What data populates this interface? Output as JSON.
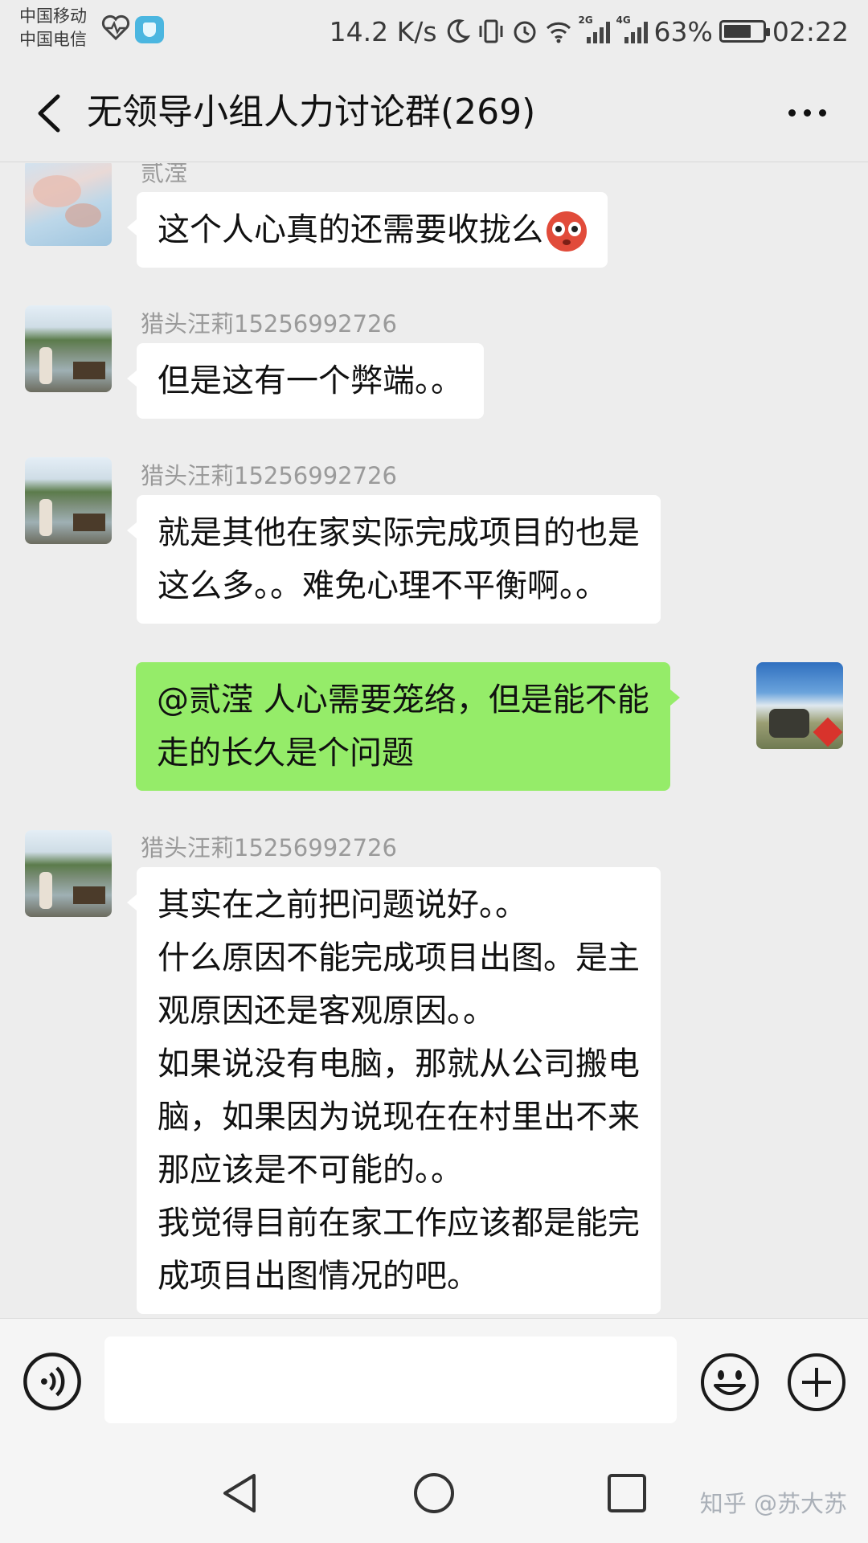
{
  "status_bar": {
    "carrier_1": "中国移动",
    "carrier_2": "中国电信",
    "net_speed": "14.2 K/s",
    "net_2g": "2G",
    "net_4g": "4G",
    "battery_percent": "63%",
    "battery_level": 0.63,
    "time": "02:22"
  },
  "header": {
    "title": "无领导小组人力讨论群(269)"
  },
  "messages": [
    {
      "sender": "贰滢",
      "direction": "in",
      "avatar": "blossom-avatar",
      "lines": [
        "这个人心真的还需要收拢么"
      ],
      "emoji": "flushed-face"
    },
    {
      "sender": "猎头汪莉15256992726",
      "direction": "in",
      "avatar": "lake-avatar",
      "lines": [
        "但是这有一个弊端。。"
      ]
    },
    {
      "sender": "猎头汪莉15256992726",
      "direction": "in",
      "avatar": "lake-avatar",
      "lines": [
        "就是其他在家实际完成项目的也是",
        "这么多。。难免心理不平衡啊。。"
      ]
    },
    {
      "sender": "",
      "direction": "out",
      "avatar": "jeep-avatar",
      "lines": [
        "@贰滢  人心需要笼络，但是能不能",
        "走的长久是个问题"
      ]
    },
    {
      "sender": "猎头汪莉15256992726",
      "direction": "in",
      "avatar": "lake-avatar",
      "lines": [
        "其实在之前把问题说好。。",
        "什么原因不能完成项目出图。是主",
        "观原因还是客观原因。。",
        "如果说没有电脑，那就从公司搬电",
        "脑，如果因为说现在在村里出不来",
        "那应该是不可能的。。",
        "我觉得目前在家工作应该都是能完",
        "成项目出图情况的吧。"
      ]
    }
  ],
  "input": {
    "value": ""
  },
  "watermark": "知乎 @苏大苏",
  "colors": {
    "background": "#ededed",
    "incoming_bubble": "#ffffff",
    "outgoing_bubble": "#95ec69",
    "sender_name": "#9a9a9a"
  }
}
